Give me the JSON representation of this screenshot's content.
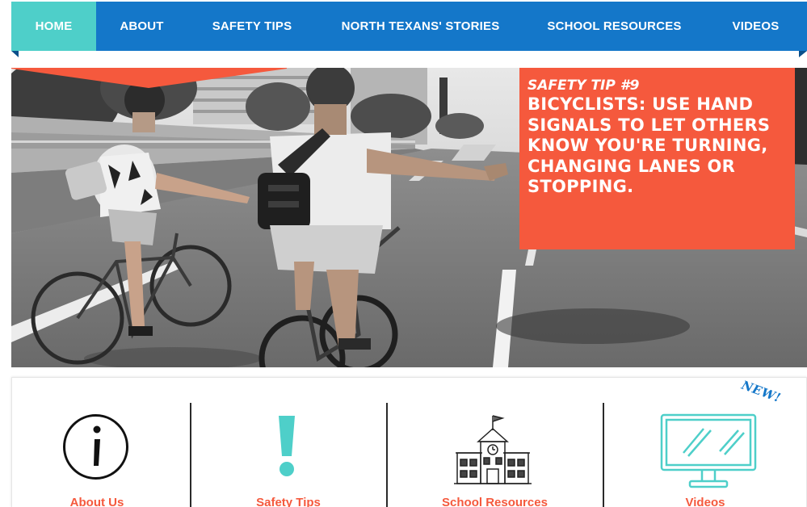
{
  "nav": {
    "items": [
      {
        "label": "HOME",
        "active": true
      },
      {
        "label": "ABOUT",
        "active": false
      },
      {
        "label": "SAFETY TIPS",
        "active": false
      },
      {
        "label": "NORTH TEXANS' STORIES",
        "active": false
      },
      {
        "label": "SCHOOL RESOURCES",
        "active": false
      },
      {
        "label": "VIDEOS",
        "active": false
      }
    ]
  },
  "hero": {
    "tip_kicker": "SAFETY TIP #9",
    "tip_text": "BICYCLISTS: USE HAND SIGNALS TO LET OTHERS KNOW YOU'RE TURNING, CHANGING LANES OR STOPPING."
  },
  "cards": [
    {
      "label": "About Us",
      "icon": "info-icon"
    },
    {
      "label": "Safety Tips",
      "icon": "exclamation-icon"
    },
    {
      "label": "School Resources",
      "icon": "school-building-icon"
    },
    {
      "label": "Videos",
      "icon": "monitor-icon"
    }
  ],
  "new_badge": "NEW!",
  "colors": {
    "nav_bg": "#1477c9",
    "nav_active": "#4ecfc9",
    "accent_orange": "#f5593d",
    "teal": "#4ecfc9"
  }
}
